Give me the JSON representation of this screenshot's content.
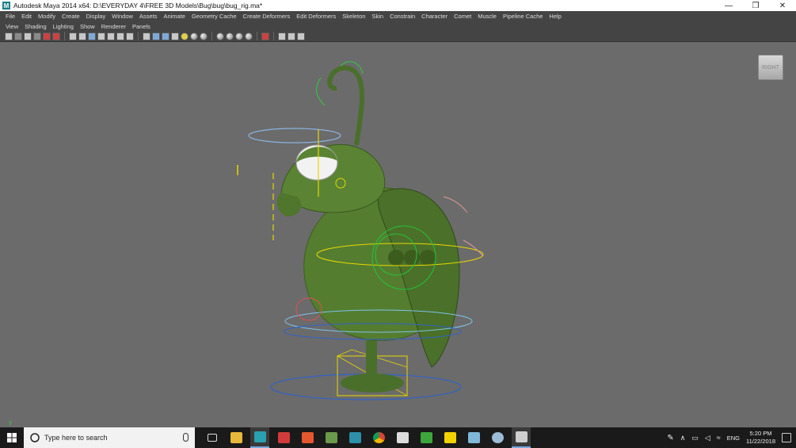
{
  "window": {
    "title": "Autodesk Maya 2014 x64: D:\\EVERYDAY 4\\FREE 3D Models\\Bug\\bug\\bug_rig.ma*",
    "icon": "maya-icon",
    "controls": {
      "minimize": "—",
      "restore": "❐",
      "close": "✕"
    }
  },
  "menubar": [
    "File",
    "Edit",
    "Modify",
    "Create",
    "Display",
    "Window",
    "Assets",
    "Animate",
    "Geometry Cache",
    "Create Deformers",
    "Edit Deformers",
    "Skeleton",
    "Skin",
    "Constrain",
    "Character",
    "Comet",
    "Muscle",
    "Pipeline Cache",
    "Help"
  ],
  "panel_menus": [
    "View",
    "Shading",
    "Lighting",
    "Show",
    "Renderer",
    "Panels"
  ],
  "viewport": {
    "background": "#6b6b6b",
    "viewcube_label": "RIGHT",
    "axis_label": "y",
    "model_color": "#4f7a2c"
  },
  "taskbar": {
    "search_placeholder": "Type here to search",
    "icons": [
      "task-view-icon",
      "file-explorer-icon",
      "maya-taskbar-icon",
      "app-icon-1",
      "app-icon-2",
      "app-icon-3",
      "app-icon-4",
      "chrome-icon",
      "app-icon-5",
      "camtasia-icon",
      "sticky-icon",
      "app-icon-6",
      "app-icon-7",
      "app-icon-8"
    ],
    "tray": {
      "language": "ENG",
      "time": "5:20 PM",
      "date": "11/22/2018"
    }
  }
}
